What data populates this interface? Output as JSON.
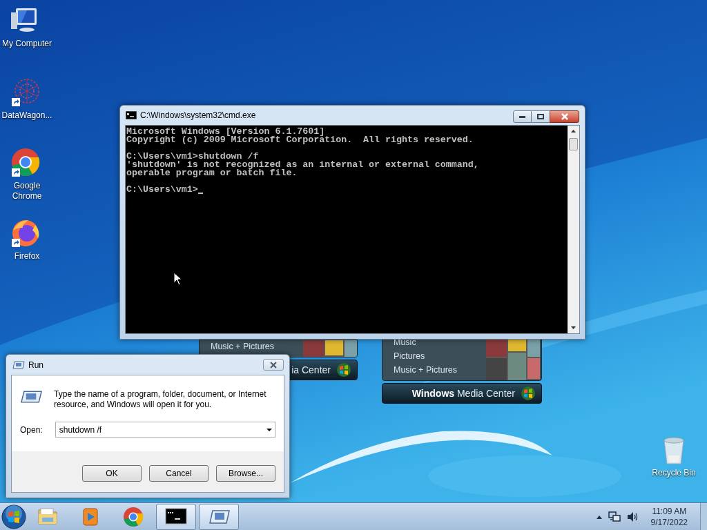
{
  "desktop_icons": [
    {
      "label": "My Computer",
      "kind": "computer",
      "shortcut": false
    },
    {
      "label": "DataWagon...",
      "kind": "datawagon",
      "shortcut": true
    },
    {
      "label": "Google Chrome",
      "kind": "chrome",
      "shortcut": true
    },
    {
      "label": "Firefox",
      "kind": "firefox",
      "shortcut": true
    }
  ],
  "recycle_bin": {
    "label": "Recycle Bin"
  },
  "gadgets": [
    {
      "items": [
        "Music + Pictures"
      ],
      "title": "ia Center"
    },
    {
      "items": [
        "Music",
        "Pictures",
        "Music + Pictures"
      ],
      "title_bold": "Windows",
      "title": "Media Center"
    }
  ],
  "cmd_window": {
    "title": "C:\\Windows\\system32\\cmd.exe",
    "blocks": [
      [
        "Microsoft Windows [Version 6.1.7601]",
        "Copyright (c) 2009 Microsoft Corporation.  All rights reserved."
      ],
      [
        "C:\\Users\\vm1>shutdown /f",
        "'shutdown' is not recognized as an internal or external command,",
        "operable program or batch file."
      ],
      [
        "C:\\Users\\vm1>"
      ]
    ],
    "cursor": true
  },
  "run_dialog": {
    "title": "Run",
    "description": "Type the name of a program, folder, document, or Internet resource, and Windows will open it for you.",
    "open_label": "Open:",
    "value": "shutdown /f",
    "buttons": [
      "OK",
      "Cancel",
      "Browse..."
    ]
  },
  "taskbar": {
    "apps": [
      {
        "kind": "explorer",
        "running": false
      },
      {
        "kind": "media",
        "running": false
      },
      {
        "kind": "chrome",
        "running": false
      },
      {
        "kind": "cmd",
        "running": true
      },
      {
        "kind": "run",
        "running": true
      }
    ],
    "time": "11:09 AM",
    "date": "9/17/2022"
  }
}
